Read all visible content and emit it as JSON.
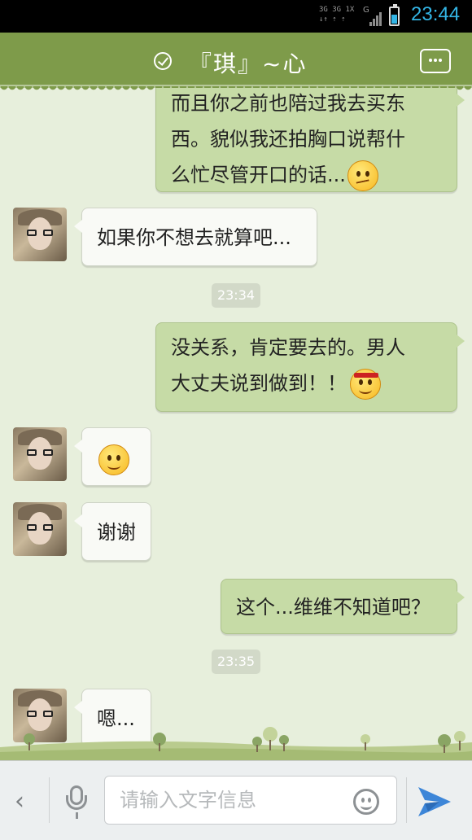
{
  "status_bar": {
    "network_lines": [
      "3G 3G 1X",
      "↓↑ ⇡ ⇡"
    ],
    "network_g": "G",
    "time": "23:44"
  },
  "header": {
    "title": "『琪』~心",
    "verified_icon": "check-circle-icon",
    "more_icon": "more-dots-icon"
  },
  "messages": [
    {
      "side": "out",
      "lines": [
        "而且你之前也陪过我去买东",
        "西。貌似我还拍胸口说帮什",
        "么忙尽管开口的话..."
      ],
      "emoji": "wry-face"
    },
    {
      "side": "in",
      "lines": [
        "如果你不想去就算吧..."
      ]
    },
    {
      "type": "timestamp",
      "text": "23:34"
    },
    {
      "side": "out",
      "lines": [
        "没关系，肯定要去的。男人",
        "大丈夫说到做到！！"
      ],
      "emoji": "headband-face"
    },
    {
      "side": "in",
      "lines": [],
      "emoji": "smile"
    },
    {
      "side": "in",
      "lines": [
        "谢谢"
      ]
    },
    {
      "side": "out",
      "lines": [
        "这个...维维不知道吧？"
      ]
    },
    {
      "type": "timestamp",
      "text": "23:35"
    },
    {
      "side": "in",
      "lines": [
        "嗯..."
      ]
    }
  ],
  "input_bar": {
    "back_icon": "chevron-left-icon",
    "voice_icon": "microphone-icon",
    "placeholder": "请输入文字信息",
    "emoji_icon": "smiley-icon",
    "send_icon": "send-plane-icon"
  },
  "colors": {
    "header_bg": "#7e9b4a",
    "chat_bg": "#e7efdc",
    "outgoing_bubble": "#c6dba6",
    "incoming_bubble": "#f9faf6",
    "clock": "#33b5e5"
  }
}
